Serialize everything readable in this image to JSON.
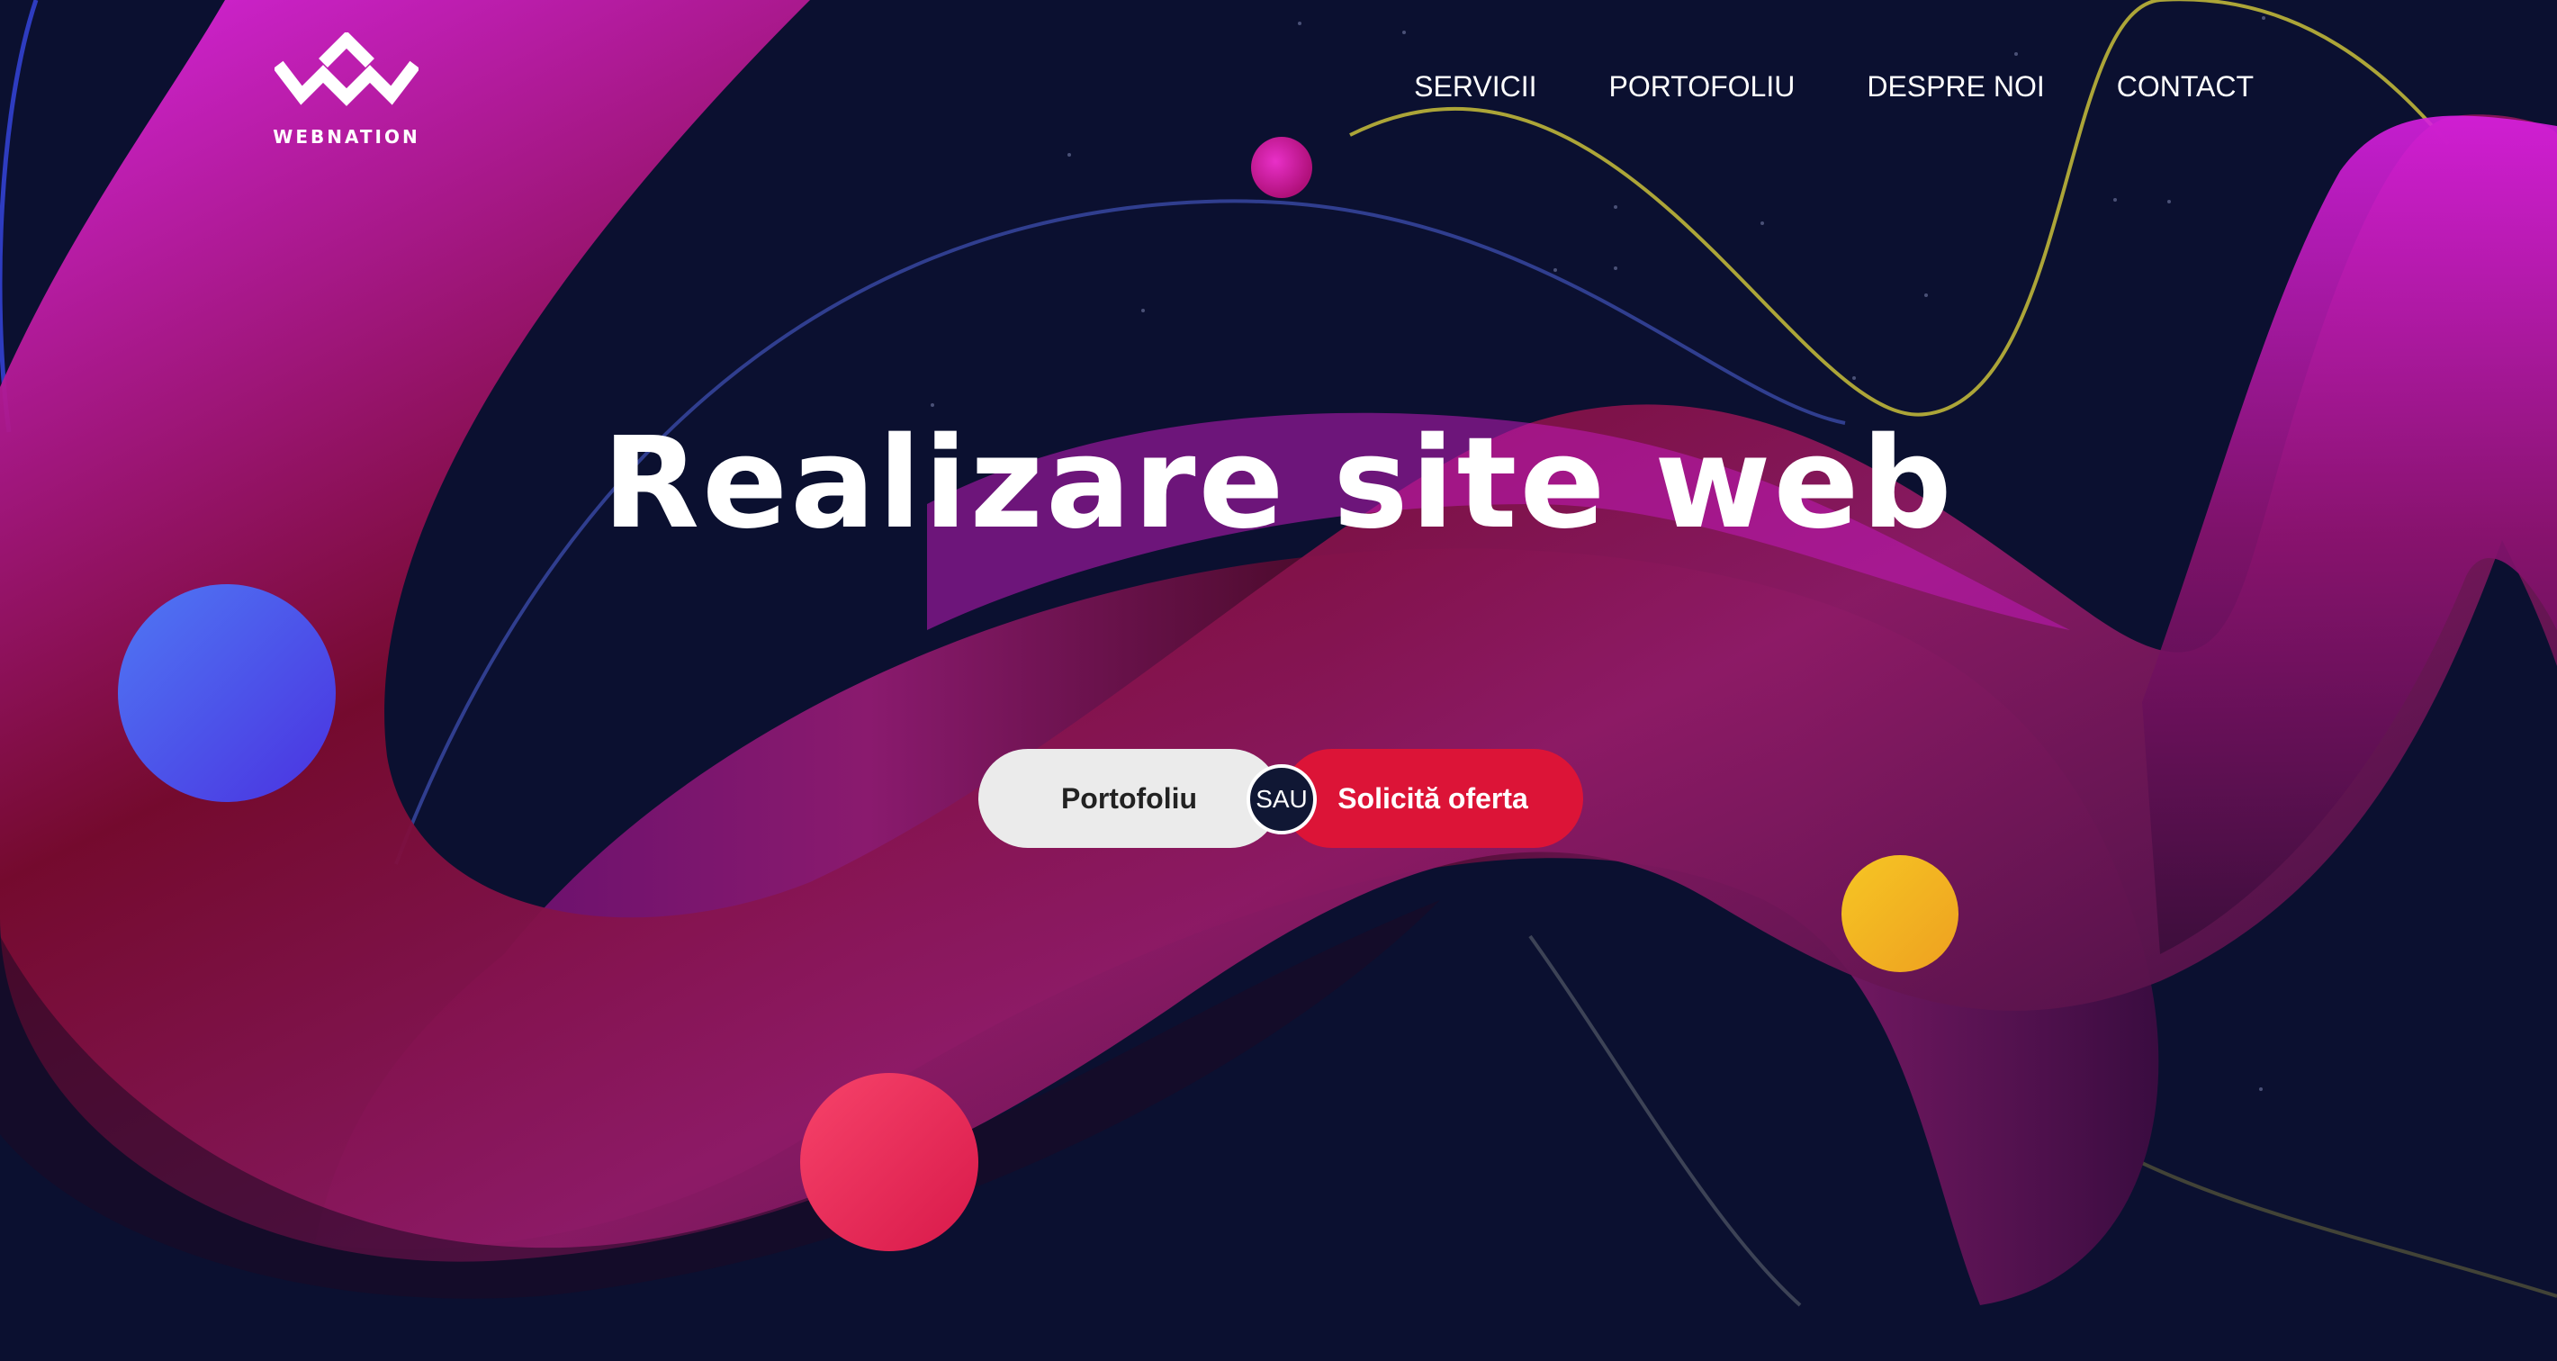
{
  "brand": {
    "name": "WEBNATION",
    "logo_icon": "webnation-w-logo-icon"
  },
  "nav": {
    "items": [
      {
        "label": "SERVICII"
      },
      {
        "label": "PORTOFOLIU"
      },
      {
        "label": "DESPRE NOI"
      },
      {
        "label": "CONTACT"
      }
    ]
  },
  "hero": {
    "title": "Realizare site web",
    "primary_button": "Portofoliu",
    "separator": "SAU",
    "secondary_button": "Solicită oferta"
  },
  "colors": {
    "background": "#0b1030",
    "accent_red": "#dc1437",
    "button_light": "#ebebeb",
    "ribbon_magenta": "#d41fd8",
    "ribbon_crimson": "#7a0a2e",
    "ball_blue": "#4f5ef0",
    "ball_yellow": "#f2b824",
    "ball_red": "#ec2f55"
  }
}
